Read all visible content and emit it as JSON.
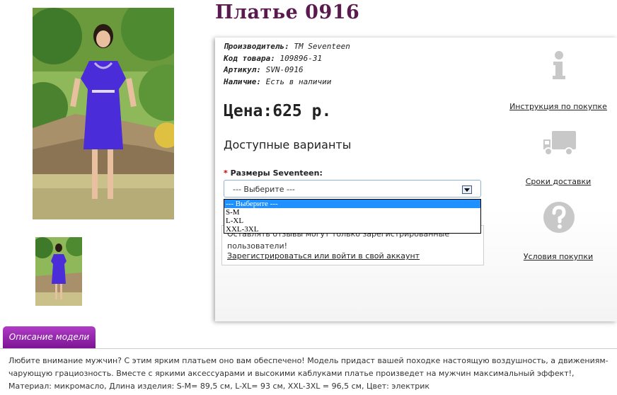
{
  "product": {
    "title": "Платье 0916",
    "info": [
      {
        "label": "Производитель:",
        "value": "TM Seventeen"
      },
      {
        "label": "Код товара:",
        "value": "109896-31"
      },
      {
        "label": "Артикул:",
        "value": "SVN-0916"
      },
      {
        "label": "Наличие:",
        "value": "Есть в наличии"
      }
    ],
    "price": "Цена:625 р."
  },
  "options": {
    "heading": "Доступные варианты",
    "required_mark": "*",
    "size_label": "Размеры Seventeen:",
    "selected": "--- Выберите ---",
    "dropdown": [
      "--- Выберите ---",
      "S-M",
      "L-XL",
      "XXL-3XL"
    ]
  },
  "login_notice": {
    "text": "Оставлять отзывы могут только зарегистрированные пользователи!",
    "link": "Зарегистрироваться или войти в свой аккаунт"
  },
  "sidebar": {
    "instructions": "Инструкция по покупке",
    "delivery": "Сроки доставки",
    "terms": "Условия покупки"
  },
  "description": {
    "tab": "Описание модели",
    "text": "Любите внимание мужчин? С этим ярким платьем оно вам обеспечено! Модель придаст вашей походке настоящую воздушность, а движениям-чарующую грациозность. Вместе с яркими аксессуарами и высокими каблуками платье произведет на мужчин максимальный эффект!, Материал: микромасло, Длина изделия: S-M= 89,5 см, L-XL= 93 см, XXL-3XL = 96,5 см, Цвет: электрик"
  },
  "colors": {
    "title": "#5a1a4f",
    "tab": "#9a28b0",
    "dress": "#4a2cd8",
    "selection": "#1e90ff"
  }
}
